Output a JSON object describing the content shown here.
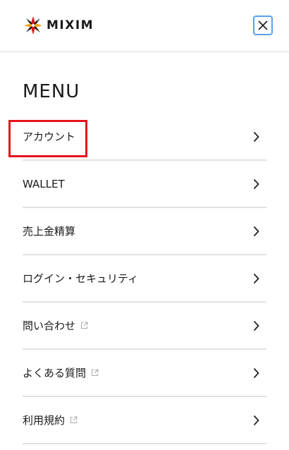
{
  "header": {
    "logo_text": "MIXIM",
    "close_icon": "close-icon"
  },
  "menu": {
    "title": "MENU",
    "items": [
      {
        "label": "アカウント",
        "external": false
      },
      {
        "label": "WALLET",
        "external": false
      },
      {
        "label": "売上金精算",
        "external": false
      },
      {
        "label": "ログイン・セキュリティ",
        "external": false
      },
      {
        "label": "問い合わせ",
        "external": true
      },
      {
        "label": "よくある質問",
        "external": true
      },
      {
        "label": "利用規約",
        "external": true
      }
    ]
  },
  "colors": {
    "highlight": "#e4131d",
    "close_border": "#5aa2e6",
    "divider": "#e2e2e2"
  }
}
